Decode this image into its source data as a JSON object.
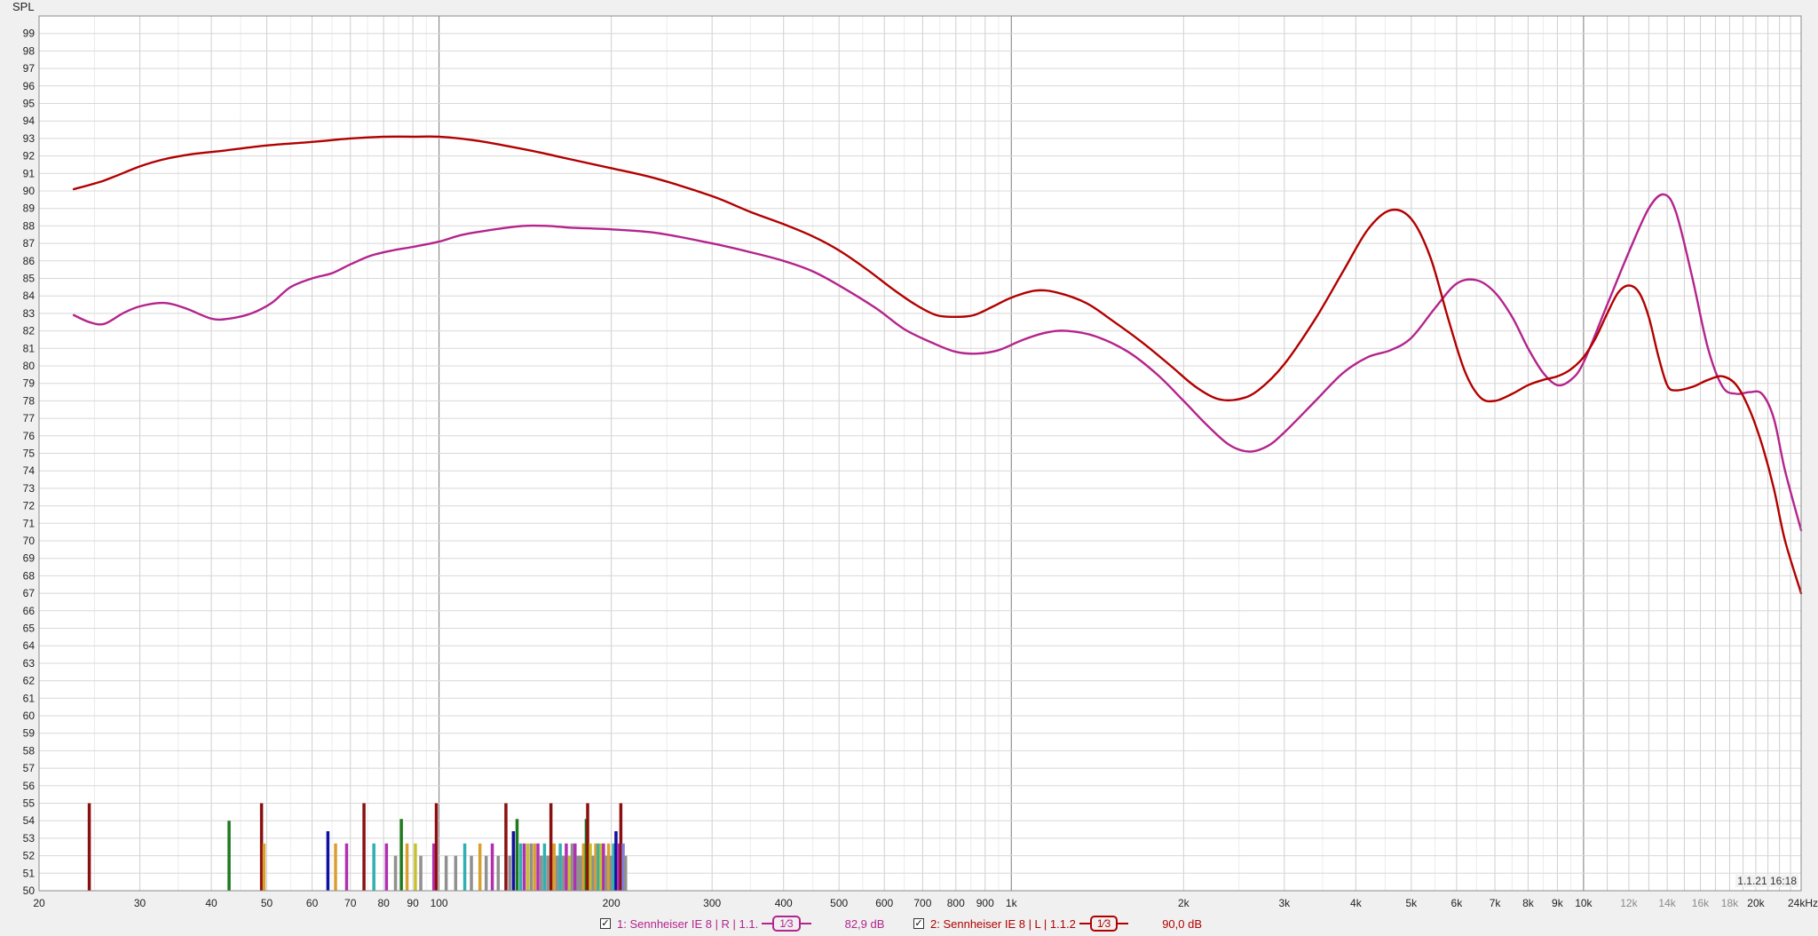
{
  "y_axis_label": "SPL",
  "timestamp": "1.1.21 16:18",
  "legend": [
    {
      "checked": true,
      "label": "1: Sennheiser IE 8 | R | 1.1.",
      "smoothing": "1/3",
      "level": "82,9 dB",
      "color": "#b4248c"
    },
    {
      "checked": true,
      "label": "2: Sennheiser IE 8 | L | 1.1.2",
      "smoothing": "1/3",
      "level": "90,0 dB",
      "color": "#b20000"
    }
  ],
  "chart_data": {
    "type": "line",
    "x_scale": "log",
    "xlim": [
      20,
      24000
    ],
    "ylim": [
      50,
      100
    ],
    "grid": true,
    "ylabel": "SPL",
    "x_ticks": [
      {
        "v": 20,
        "t": "20"
      },
      {
        "v": 30,
        "t": "30"
      },
      {
        "v": 40,
        "t": "40"
      },
      {
        "v": 50,
        "t": "50"
      },
      {
        "v": 60,
        "t": "60"
      },
      {
        "v": 70,
        "t": "70"
      },
      {
        "v": 80,
        "t": "80"
      },
      {
        "v": 90,
        "t": "90"
      },
      {
        "v": 100,
        "t": "100"
      },
      {
        "v": 200,
        "t": "200"
      },
      {
        "v": 300,
        "t": "300"
      },
      {
        "v": 400,
        "t": "400"
      },
      {
        "v": 500,
        "t": "500"
      },
      {
        "v": 600,
        "t": "600"
      },
      {
        "v": 700,
        "t": "700"
      },
      {
        "v": 800,
        "t": "800"
      },
      {
        "v": 900,
        "t": "900"
      },
      {
        "v": 1000,
        "t": "1k"
      },
      {
        "v": 2000,
        "t": "2k"
      },
      {
        "v": 3000,
        "t": "3k"
      },
      {
        "v": 4000,
        "t": "4k"
      },
      {
        "v": 5000,
        "t": "5k"
      },
      {
        "v": 6000,
        "t": "6k"
      },
      {
        "v": 7000,
        "t": "7k"
      },
      {
        "v": 8000,
        "t": "8k"
      },
      {
        "v": 9000,
        "t": "9k"
      },
      {
        "v": 10000,
        "t": "10k"
      },
      {
        "v": 12000,
        "t": "12k",
        "faint": true
      },
      {
        "v": 14000,
        "t": "14k",
        "faint": true
      },
      {
        "v": 16000,
        "t": "16k",
        "faint": true
      },
      {
        "v": 18000,
        "t": "18k",
        "faint": true
      },
      {
        "v": 20000,
        "t": "20k"
      },
      {
        "v": 24000,
        "t": "24kHz"
      }
    ],
    "y_ticks": [
      50,
      51,
      52,
      53,
      54,
      55,
      56,
      57,
      58,
      59,
      60,
      61,
      62,
      63,
      64,
      65,
      66,
      67,
      68,
      69,
      70,
      71,
      72,
      73,
      74,
      75,
      76,
      77,
      78,
      79,
      80,
      81,
      82,
      83,
      84,
      85,
      86,
      87,
      88,
      89,
      90,
      91,
      92,
      93,
      94,
      95,
      96,
      97,
      98,
      99
    ],
    "series": [
      {
        "name": "1: Sennheiser IE 8 | R | 1.1.",
        "color": "#b4248c",
        "points": [
          [
            23,
            82.9
          ],
          [
            24.5,
            82.5
          ],
          [
            26,
            82.4
          ],
          [
            28,
            83.0
          ],
          [
            30,
            83.4
          ],
          [
            33,
            83.6
          ],
          [
            36,
            83.3
          ],
          [
            40,
            82.7
          ],
          [
            43,
            82.7
          ],
          [
            47,
            83.0
          ],
          [
            51,
            83.6
          ],
          [
            55,
            84.5
          ],
          [
            60,
            85.0
          ],
          [
            65,
            85.3
          ],
          [
            70,
            85.8
          ],
          [
            76,
            86.3
          ],
          [
            83,
            86.6
          ],
          [
            90,
            86.8
          ],
          [
            100,
            87.1
          ],
          [
            110,
            87.5
          ],
          [
            125,
            87.8
          ],
          [
            140,
            88.0
          ],
          [
            155,
            88.0
          ],
          [
            170,
            87.9
          ],
          [
            200,
            87.8
          ],
          [
            240,
            87.6
          ],
          [
            300,
            87.0
          ],
          [
            350,
            86.5
          ],
          [
            400,
            86.0
          ],
          [
            450,
            85.4
          ],
          [
            500,
            84.6
          ],
          [
            580,
            83.3
          ],
          [
            650,
            82.1
          ],
          [
            730,
            81.3
          ],
          [
            800,
            80.8
          ],
          [
            870,
            80.7
          ],
          [
            950,
            80.9
          ],
          [
            1050,
            81.5
          ],
          [
            1150,
            81.9
          ],
          [
            1250,
            82.0
          ],
          [
            1400,
            81.7
          ],
          [
            1600,
            80.8
          ],
          [
            1800,
            79.5
          ],
          [
            2000,
            78.0
          ],
          [
            2200,
            76.6
          ],
          [
            2400,
            75.5
          ],
          [
            2600,
            75.1
          ],
          [
            2800,
            75.4
          ],
          [
            3000,
            76.2
          ],
          [
            3400,
            78.0
          ],
          [
            3800,
            79.6
          ],
          [
            4200,
            80.5
          ],
          [
            4600,
            80.9
          ],
          [
            5000,
            81.6
          ],
          [
            5500,
            83.3
          ],
          [
            6000,
            84.7
          ],
          [
            6500,
            84.9
          ],
          [
            7000,
            84.2
          ],
          [
            7500,
            82.8
          ],
          [
            8000,
            81.0
          ],
          [
            8500,
            79.6
          ],
          [
            9000,
            78.9
          ],
          [
            9500,
            79.2
          ],
          [
            10000,
            80.2
          ],
          [
            11000,
            83.5
          ],
          [
            12000,
            86.5
          ],
          [
            13000,
            89.0
          ],
          [
            13800,
            89.8
          ],
          [
            14500,
            88.8
          ],
          [
            15500,
            85.0
          ],
          [
            16500,
            81.0
          ],
          [
            17500,
            78.8
          ],
          [
            18500,
            78.4
          ],
          [
            19500,
            78.5
          ],
          [
            20500,
            78.4
          ],
          [
            21500,
            77.0
          ],
          [
            22500,
            74.0
          ],
          [
            24000,
            70.6
          ]
        ]
      },
      {
        "name": "2: Sennheiser IE 8 | L | 1.1.2",
        "color": "#b20000",
        "points": [
          [
            23,
            90.1
          ],
          [
            26,
            90.6
          ],
          [
            30,
            91.4
          ],
          [
            33,
            91.8
          ],
          [
            37,
            92.1
          ],
          [
            42,
            92.3
          ],
          [
            50,
            92.6
          ],
          [
            60,
            92.8
          ],
          [
            70,
            93.0
          ],
          [
            80,
            93.1
          ],
          [
            90,
            93.1
          ],
          [
            100,
            93.1
          ],
          [
            115,
            92.9
          ],
          [
            130,
            92.6
          ],
          [
            150,
            92.2
          ],
          [
            170,
            91.8
          ],
          [
            200,
            91.3
          ],
          [
            240,
            90.7
          ],
          [
            300,
            89.7
          ],
          [
            350,
            88.8
          ],
          [
            400,
            88.1
          ],
          [
            450,
            87.4
          ],
          [
            500,
            86.6
          ],
          [
            560,
            85.5
          ],
          [
            620,
            84.4
          ],
          [
            680,
            83.5
          ],
          [
            740,
            82.9
          ],
          [
            800,
            82.8
          ],
          [
            860,
            82.9
          ],
          [
            930,
            83.4
          ],
          [
            1000,
            83.9
          ],
          [
            1100,
            84.3
          ],
          [
            1200,
            84.2
          ],
          [
            1350,
            83.6
          ],
          [
            1500,
            82.6
          ],
          [
            1700,
            81.3
          ],
          [
            1900,
            80.0
          ],
          [
            2100,
            78.8
          ],
          [
            2300,
            78.1
          ],
          [
            2500,
            78.1
          ],
          [
            2700,
            78.6
          ],
          [
            3000,
            80.1
          ],
          [
            3400,
            82.7
          ],
          [
            3800,
            85.4
          ],
          [
            4200,
            87.8
          ],
          [
            4600,
            88.9
          ],
          [
            5000,
            88.4
          ],
          [
            5400,
            86.2
          ],
          [
            5800,
            82.7
          ],
          [
            6200,
            79.7
          ],
          [
            6600,
            78.2
          ],
          [
            7000,
            78.0
          ],
          [
            7500,
            78.4
          ],
          [
            8000,
            78.9
          ],
          [
            8500,
            79.2
          ],
          [
            9000,
            79.4
          ],
          [
            9500,
            79.8
          ],
          [
            10000,
            80.5
          ],
          [
            10500,
            81.6
          ],
          [
            11000,
            83.0
          ],
          [
            11500,
            84.2
          ],
          [
            12000,
            84.6
          ],
          [
            12500,
            84.2
          ],
          [
            13000,
            82.8
          ],
          [
            13500,
            80.6
          ],
          [
            14000,
            78.9
          ],
          [
            14500,
            78.6
          ],
          [
            15500,
            78.8
          ],
          [
            16500,
            79.2
          ],
          [
            17500,
            79.4
          ],
          [
            18500,
            78.9
          ],
          [
            19500,
            77.5
          ],
          [
            20500,
            75.5
          ],
          [
            21500,
            73.0
          ],
          [
            22500,
            70.0
          ],
          [
            24000,
            67.0
          ]
        ]
      }
    ],
    "bars": [
      {
        "f": 24.5,
        "v": 55,
        "c": "#8a1010"
      },
      {
        "f": 43,
        "v": 54,
        "c": "#1e7a1e"
      },
      {
        "f": 49,
        "v": 55,
        "c": "#8a1010"
      },
      {
        "f": 49.5,
        "v": 52.7,
        "c": "#d8a030"
      },
      {
        "f": 64,
        "v": 53.4,
        "c": "#1010a0"
      },
      {
        "f": 66,
        "v": 52.7,
        "c": "#d8a030"
      },
      {
        "f": 69,
        "v": 52.7,
        "c": "#b030b0"
      },
      {
        "f": 74,
        "v": 55,
        "c": "#8a1010"
      },
      {
        "f": 77,
        "v": 52.7,
        "c": "#30b0b0"
      },
      {
        "f": 81,
        "v": 52.7,
        "c": "#b030b0"
      },
      {
        "f": 84,
        "v": 52.0,
        "c": "#909090"
      },
      {
        "f": 86,
        "v": 54.1,
        "c": "#1e7a1e"
      },
      {
        "f": 88,
        "v": 52.7,
        "c": "#d8a030"
      },
      {
        "f": 91,
        "v": 52.7,
        "c": "#c8c030"
      },
      {
        "f": 93,
        "v": 52.0,
        "c": "#909090"
      },
      {
        "f": 98,
        "v": 52.7,
        "c": "#b030b0"
      },
      {
        "f": 99,
        "v": 55,
        "c": "#8a1010"
      },
      {
        "f": 103,
        "v": 52.0,
        "c": "#909090"
      },
      {
        "f": 107,
        "v": 52.0,
        "c": "#909090"
      },
      {
        "f": 111,
        "v": 52.7,
        "c": "#30b0b0"
      },
      {
        "f": 114,
        "v": 52.0,
        "c": "#909090"
      },
      {
        "f": 118,
        "v": 52.7,
        "c": "#d8a030"
      },
      {
        "f": 121,
        "v": 52.0,
        "c": "#909090"
      },
      {
        "f": 124,
        "v": 52.7,
        "c": "#b030b0"
      },
      {
        "f": 127,
        "v": 52.0,
        "c": "#909090"
      },
      {
        "f": 131,
        "v": 55,
        "c": "#8a1010"
      },
      {
        "f": 133,
        "v": 52.0,
        "c": "#909090"
      },
      {
        "f": 135,
        "v": 53.4,
        "c": "#1010a0"
      },
      {
        "f": 137,
        "v": 54.1,
        "c": "#1e7a1e"
      },
      {
        "f": 139,
        "v": 52.7,
        "c": "#30b0b0"
      },
      {
        "f": 141,
        "v": 52.7,
        "c": "#b030b0"
      },
      {
        "f": 143,
        "v": 52.7,
        "c": "#c8c030"
      },
      {
        "f": 145,
        "v": 52.7,
        "c": "#909090"
      },
      {
        "f": 147,
        "v": 52.7,
        "c": "#d8a030"
      },
      {
        "f": 149,
        "v": 52.7,
        "c": "#b030b0"
      },
      {
        "f": 151,
        "v": 52.0,
        "c": "#909090"
      },
      {
        "f": 153,
        "v": 52.7,
        "c": "#30b0b0"
      },
      {
        "f": 155,
        "v": 52.0,
        "c": "#909090"
      },
      {
        "f": 157,
        "v": 55,
        "c": "#8a1010"
      },
      {
        "f": 159,
        "v": 52.7,
        "c": "#d8a030"
      },
      {
        "f": 161,
        "v": 52.0,
        "c": "#909090"
      },
      {
        "f": 163,
        "v": 52.7,
        "c": "#30b0b0"
      },
      {
        "f": 165,
        "v": 52.0,
        "c": "#909090"
      },
      {
        "f": 167,
        "v": 52.7,
        "c": "#b030b0"
      },
      {
        "f": 169,
        "v": 52.0,
        "c": "#c8c030"
      },
      {
        "f": 171,
        "v": 52.7,
        "c": "#909090"
      },
      {
        "f": 173,
        "v": 52.7,
        "c": "#b030b0"
      },
      {
        "f": 175,
        "v": 52.0,
        "c": "#909090"
      },
      {
        "f": 177,
        "v": 52.0,
        "c": "#909090"
      },
      {
        "f": 179,
        "v": 52.7,
        "c": "#d8a030"
      },
      {
        "f": 181,
        "v": 54.1,
        "c": "#1e7a1e"
      },
      {
        "f": 182,
        "v": 55,
        "c": "#8a1010"
      },
      {
        "f": 184,
        "v": 52.7,
        "c": "#c8c030"
      },
      {
        "f": 186,
        "v": 52.0,
        "c": "#909090"
      },
      {
        "f": 188,
        "v": 52.7,
        "c": "#d8a030"
      },
      {
        "f": 190,
        "v": 52.7,
        "c": "#30b0b0"
      },
      {
        "f": 192,
        "v": 52.7,
        "c": "#c8c030"
      },
      {
        "f": 194,
        "v": 52.7,
        "c": "#b030b0"
      },
      {
        "f": 196,
        "v": 52.0,
        "c": "#909090"
      },
      {
        "f": 198,
        "v": 52.7,
        "c": "#d8a030"
      },
      {
        "f": 200,
        "v": 52.0,
        "c": "#909090"
      },
      {
        "f": 202,
        "v": 52.7,
        "c": "#30b0b0"
      },
      {
        "f": 204,
        "v": 53.4,
        "c": "#1010a0"
      },
      {
        "f": 206,
        "v": 52.7,
        "c": "#b030b0"
      },
      {
        "f": 208,
        "v": 55,
        "c": "#8a1010"
      },
      {
        "f": 210,
        "v": 52.7,
        "c": "#8080e0"
      },
      {
        "f": 212,
        "v": 52.0,
        "c": "#909090"
      }
    ]
  }
}
